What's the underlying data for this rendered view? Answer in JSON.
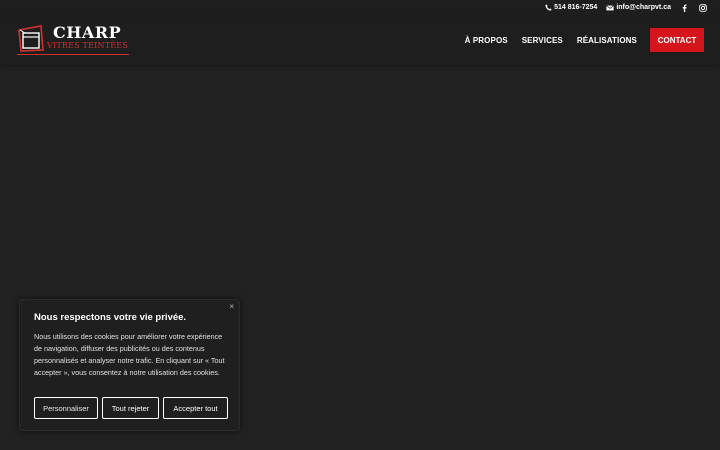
{
  "topbar": {
    "phone": "514 816-7254",
    "email": "info@charpvt.ca",
    "social": [
      "facebook-icon",
      "instagram-icon"
    ]
  },
  "logo": {
    "main": "CHARP",
    "sub": "VITRES TEINTÉES"
  },
  "nav": {
    "items": [
      "À PROPOS",
      "SERVICES",
      "RÉALISATIONS"
    ],
    "cta": "CONTACT"
  },
  "cookie": {
    "close": "×",
    "title": "Nous respectons votre vie privée.",
    "text": "Nous utilisons des cookies pour améliorer votre expérience de navigation, diffuser des publicités ou des contenus personnalisés et analyser notre trafic. En cliquant sur « Tout accepter », vous consentez à notre utilisation des cookies.",
    "buttons": {
      "customize": "Personnaliser",
      "reject": "Tout rejeter",
      "accept": "Accepter tout"
    }
  },
  "colors": {
    "background": "#222222",
    "header": "#1e1e1e",
    "accent": "#d4151c",
    "logo_red": "#d32f2f"
  }
}
